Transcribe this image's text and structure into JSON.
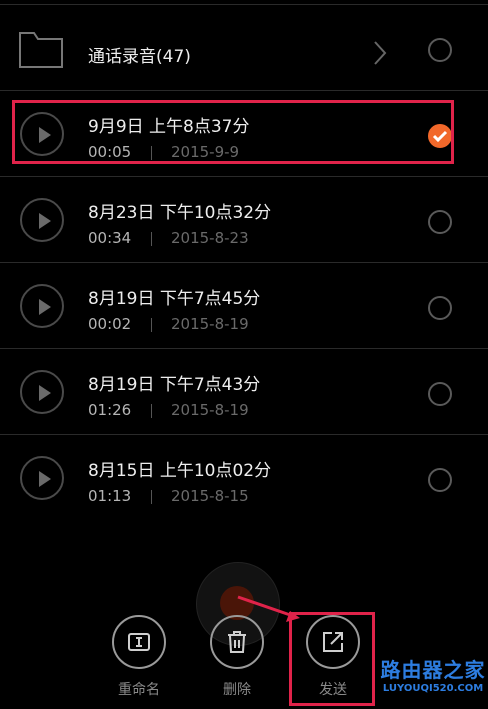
{
  "folder": {
    "label": "通话录音(47)"
  },
  "recordings": [
    {
      "title": "9月9日 上午8点37分",
      "duration": "00:05",
      "date": "2015-9-9",
      "selected": true
    },
    {
      "title": "8月23日 下午10点32分",
      "duration": "00:34",
      "date": "2015-8-23",
      "selected": false
    },
    {
      "title": "8月19日 下午7点45分",
      "duration": "00:02",
      "date": "2015-8-19",
      "selected": false
    },
    {
      "title": "8月19日 下午7点43分",
      "duration": "01:26",
      "date": "2015-8-19",
      "selected": false
    },
    {
      "title": "8月15日 上午10点02分",
      "duration": "01:13",
      "date": "2015-8-15",
      "selected": false
    }
  ],
  "actions": {
    "rename": "重命名",
    "delete": "删除",
    "send": "发送"
  },
  "watermark": {
    "main": "路由器之家",
    "sub": "LUYOUQI520.COM"
  },
  "colors": {
    "accent": "#f2682a",
    "highlight": "#e0234a",
    "watermark": "#2d7de0"
  }
}
